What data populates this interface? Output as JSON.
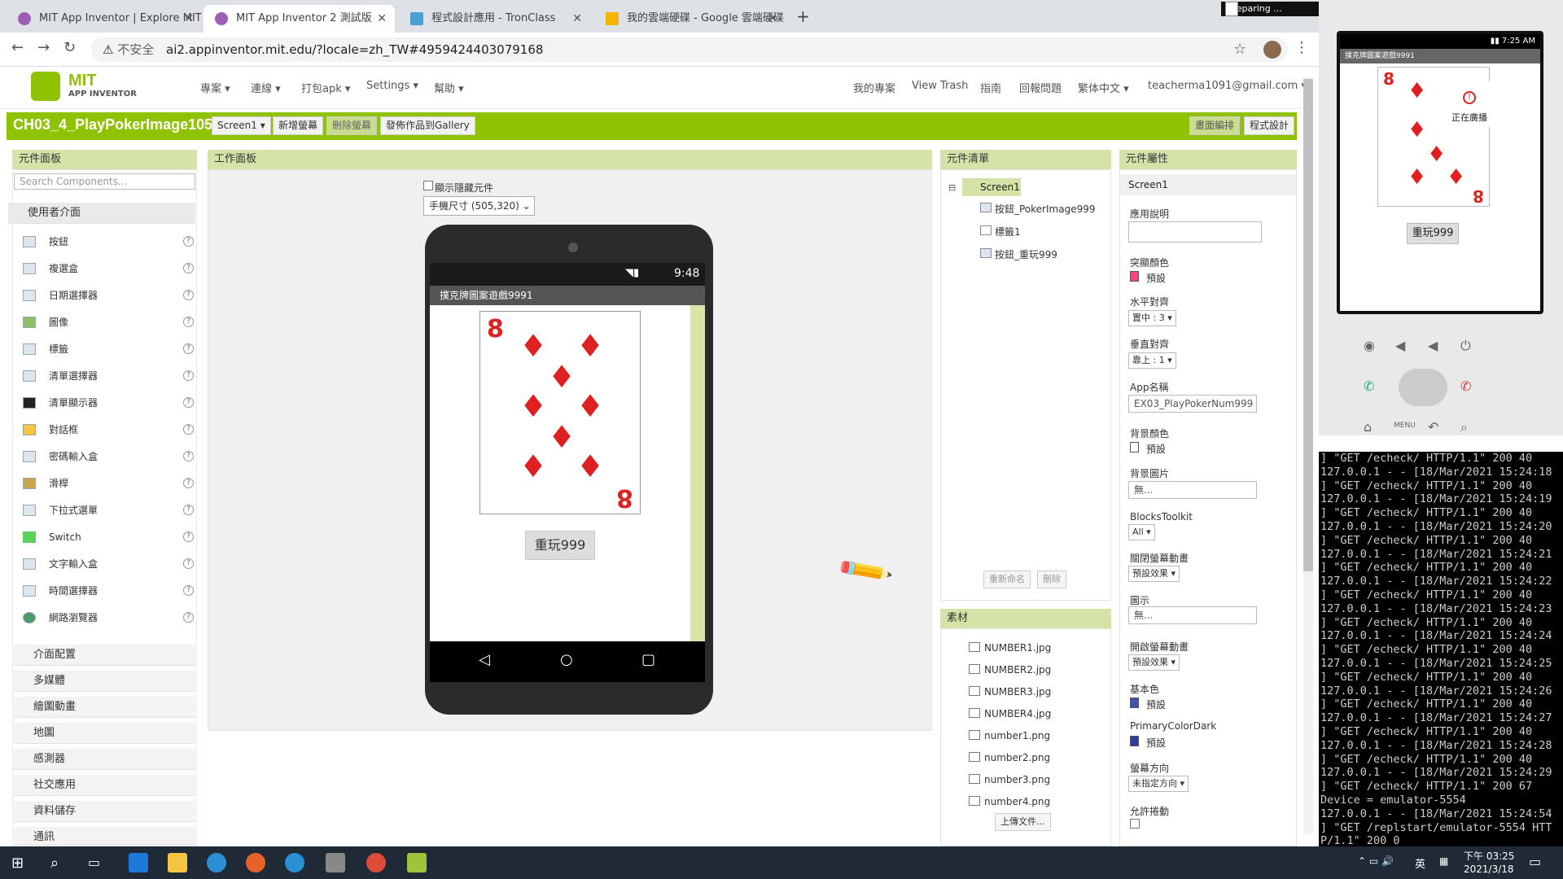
{
  "browser": {
    "tabs": [
      {
        "title": "MIT App Inventor | Explore MIT"
      },
      {
        "title": "MIT App Inventor 2 測試版"
      },
      {
        "title": "程式設計應用 - TronClass"
      },
      {
        "title": "我的雲端硬碟 - Google 雲端硬碟"
      }
    ],
    "new_tab": "+",
    "insecure": "不安全",
    "url": "ai2.appinventor.mit.edu/?locale=zh_TW#4959424403079168",
    "capture_label": "Preparing ..."
  },
  "app": {
    "logo_top": "MIT",
    "logo_bottom": "APP INVENTOR",
    "menus": [
      "專案 ▾",
      "連線 ▾",
      "打包apk ▾",
      "Settings ▾",
      "幫助 ▾"
    ],
    "right_menus": [
      "我的專案",
      "View Trash",
      "指南",
      "回報問題",
      "繁体中文 ▾",
      "teacherma1091@gmail.com ▾"
    ],
    "project_name": "CH03_4_PlayPokerImage105",
    "screen_select": "Screen1 ▾",
    "add_screen": "新增螢幕",
    "remove_screen": "刪除螢幕",
    "publish": "發佈作品到Gallery",
    "designer": "畫面編排",
    "blocks": "程式設計"
  },
  "palette": {
    "title": "元件面板",
    "search_placeholder": "Search Components...",
    "category_open": "使用者介面",
    "items": [
      "按鈕",
      "複選盒",
      "日期選擇器",
      "圖像",
      "標籤",
      "清單選擇器",
      "清單顯示器",
      "對話框",
      "密碼輸入盒",
      "滑桿",
      "下拉式選單",
      "Switch",
      "文字輸入盒",
      "時間選擇器",
      "網路瀏覽器"
    ],
    "categories": [
      "介面配置",
      "多媒體",
      "繪圖動畫",
      "地圖",
      "感測器",
      "社交應用",
      "資料儲存",
      "通訊"
    ]
  },
  "viewer": {
    "title": "工作面板",
    "show_hidden": "顯示隱藏元件",
    "size_select": "手機尺寸 (505,320)",
    "status_time": "9:48",
    "app_title": "撲克牌圖案遊戲9991",
    "card_rank": "8",
    "button_text": "重玩999"
  },
  "components": {
    "title": "元件清單",
    "root": "Screen1",
    "items": [
      "按鈕_PokerImage999",
      "標籤1",
      "按鈕_重玩999"
    ],
    "rename": "重新命名",
    "delete": "刪除"
  },
  "media": {
    "title": "素材",
    "files": [
      "NUMBER1.jpg",
      "NUMBER2.jpg",
      "NUMBER3.jpg",
      "NUMBER4.jpg",
      "number1.png",
      "number2.png",
      "number3.png",
      "number4.png"
    ],
    "upload": "上傳文件..."
  },
  "properties": {
    "title": "元件屬性",
    "screen": "Screen1",
    "about_label": "應用說明",
    "accent_label": "突顯顏色",
    "accent_value": "預設",
    "halign_label": "水平對齊",
    "halign_value": "置中 : 3 ▾",
    "valign_label": "垂直對齊",
    "valign_value": "靠上 : 1 ▾",
    "appname_label": "App名稱",
    "appname_value": "EX03_PlayPokerNum999",
    "bgcolor_label": "背景顏色",
    "bgcolor_value": "預設",
    "bgimage_label": "背景圖片",
    "bgimage_value": "無...",
    "toolkit_label": "BlocksToolkit",
    "toolkit_value": "All ▾",
    "close_anim_label": "關閉螢幕動畫",
    "close_anim_value": "預設效果 ▾",
    "icon_label": "圖示",
    "icon_value": "無...",
    "open_anim_label": "開啟螢幕動畫",
    "open_anim_value": "預設效果 ▾",
    "primary_label": "基本色",
    "primary_value": "預設",
    "primary_dark_label": "PrimaryColorDark",
    "primary_dark_value": "預設",
    "orientation_label": "螢幕方向",
    "orientation_value": "未指定方向 ▾",
    "scroll_label": "允許捲動",
    "colors": {
      "accent": "#ff4081",
      "bg": "#ffffff",
      "primary": "#3f51b5",
      "primary_dark": "#303f9f"
    }
  },
  "emulator": {
    "time": "7:25 AM",
    "app_title": "撲克牌圖案遊戲9991",
    "toast": "正在廣播",
    "button_text": "重玩999"
  },
  "console_lines": [
    "] \"GET /echeck/ HTTP/1.1\" 200 40",
    "127.0.0.1 - - [18/Mar/2021 15:24:18",
    "] \"GET /echeck/ HTTP/1.1\" 200 40",
    "127.0.0.1 - - [18/Mar/2021 15:24:19",
    "] \"GET /echeck/ HTTP/1.1\" 200 40",
    "127.0.0.1 - - [18/Mar/2021 15:24:20",
    "] \"GET /echeck/ HTTP/1.1\" 200 40",
    "127.0.0.1 - - [18/Mar/2021 15:24:21",
    "] \"GET /echeck/ HTTP/1.1\" 200 40",
    "127.0.0.1 - - [18/Mar/2021 15:24:22",
    "] \"GET /echeck/ HTTP/1.1\" 200 40",
    "127.0.0.1 - - [18/Mar/2021 15:24:23",
    "] \"GET /echeck/ HTTP/1.1\" 200 40",
    "127.0.0.1 - - [18/Mar/2021 15:24:24",
    "] \"GET /echeck/ HTTP/1.1\" 200 40",
    "127.0.0.1 - - [18/Mar/2021 15:24:25",
    "] \"GET /echeck/ HTTP/1.1\" 200 40",
    "127.0.0.1 - - [18/Mar/2021 15:24:26",
    "] \"GET /echeck/ HTTP/1.1\" 200 40",
    "127.0.0.1 - - [18/Mar/2021 15:24:27",
    "] \"GET /echeck/ HTTP/1.1\" 200 40",
    "127.0.0.1 - - [18/Mar/2021 15:24:28",
    "] \"GET /echeck/ HTTP/1.1\" 200 40",
    "127.0.0.1 - - [18/Mar/2021 15:24:29",
    "] \"GET /echeck/ HTTP/1.1\" 200 67",
    "Device = emulator-5554",
    "127.0.0.1 - - [18/Mar/2021 15:24:54",
    "] \"GET /replstart/emulator-5554 HTT",
    "P/1.1\" 200 0"
  ],
  "taskbar": {
    "time": "下午 03:25",
    "date": "2021/3/18",
    "ime": "英"
  }
}
